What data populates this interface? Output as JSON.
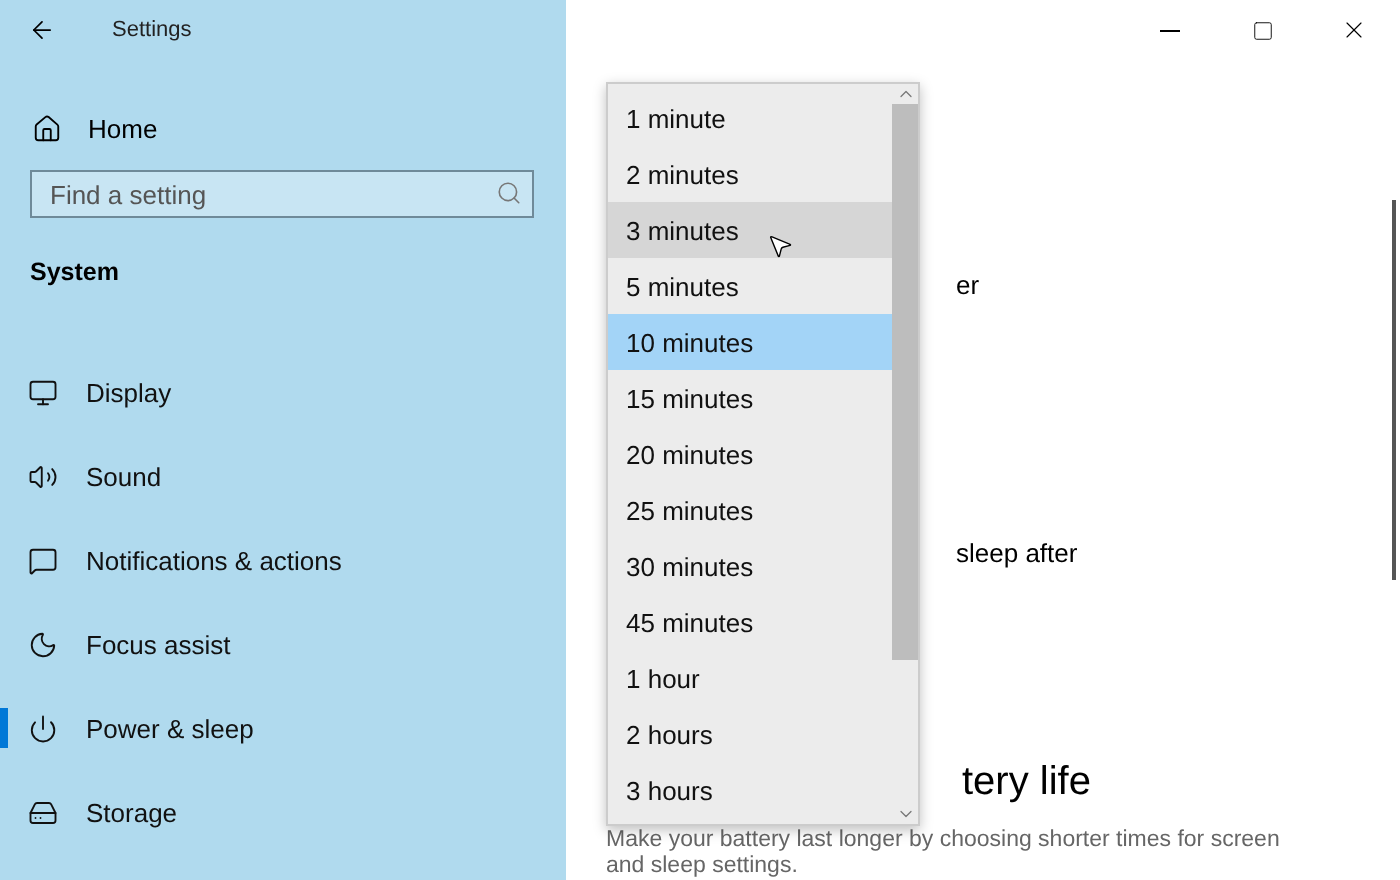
{
  "window": {
    "title": "Settings"
  },
  "sidebar": {
    "home": "Home",
    "search": {
      "placeholder": "Find a setting"
    },
    "section": "System",
    "items": [
      {
        "label": "Display",
        "selected": false
      },
      {
        "label": "Sound",
        "selected": false
      },
      {
        "label": "Notifications & actions",
        "selected": false
      },
      {
        "label": "Focus assist",
        "selected": false
      },
      {
        "label": "Power & sleep",
        "selected": true
      },
      {
        "label": "Storage",
        "selected": false
      }
    ]
  },
  "content": {
    "partial_texts": [
      "er",
      "sleep after"
    ],
    "heading": "tery life",
    "description": "Make your battery last longer by choosing shorter times for screen and sleep settings."
  },
  "dropdown": {
    "options": [
      {
        "label": "1 minute",
        "selected": false,
        "hovered": false
      },
      {
        "label": "2 minutes",
        "selected": false,
        "hovered": false
      },
      {
        "label": "3 minutes",
        "selected": false,
        "hovered": true
      },
      {
        "label": "5 minutes",
        "selected": false,
        "hovered": false
      },
      {
        "label": "10 minutes",
        "selected": true,
        "hovered": false
      },
      {
        "label": "15 minutes",
        "selected": false,
        "hovered": false
      },
      {
        "label": "20 minutes",
        "selected": false,
        "hovered": false
      },
      {
        "label": "25 minutes",
        "selected": false,
        "hovered": false
      },
      {
        "label": "30 minutes",
        "selected": false,
        "hovered": false
      },
      {
        "label": "45 minutes",
        "selected": false,
        "hovered": false
      },
      {
        "label": "1 hour",
        "selected": false,
        "hovered": false
      },
      {
        "label": "2 hours",
        "selected": false,
        "hovered": false
      },
      {
        "label": "3 hours",
        "selected": false,
        "hovered": false
      }
    ]
  }
}
